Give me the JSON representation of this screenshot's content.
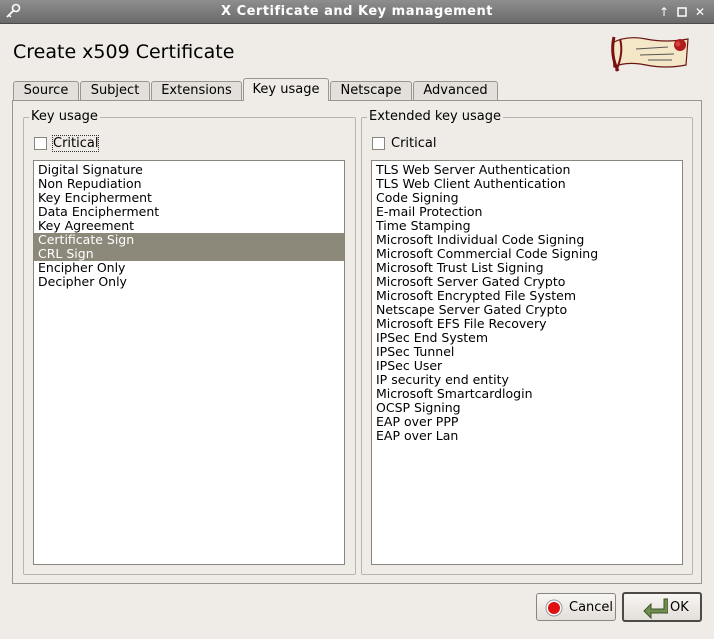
{
  "window": {
    "title": "X Certificate and Key management"
  },
  "header": {
    "title": "Create x509 Certificate"
  },
  "tabs": [
    {
      "label": "Source"
    },
    {
      "label": "Subject"
    },
    {
      "label": "Extensions"
    },
    {
      "label": "Key usage"
    },
    {
      "label": "Netscape"
    },
    {
      "label": "Advanced"
    }
  ],
  "key_usage": {
    "title": "Key usage",
    "critical_label": "Critical",
    "critical_checked": false,
    "items": [
      "Digital Signature",
      "Non Repudiation",
      "Key Encipherment",
      "Data Encipherment",
      "Key Agreement",
      "Certificate Sign",
      "CRL Sign",
      "Encipher Only",
      "Decipher Only"
    ]
  },
  "extended_key_usage": {
    "title": "Extended key usage",
    "critical_label": "Critical",
    "critical_checked": false,
    "items": [
      "TLS Web Server Authentication",
      "TLS Web Client Authentication",
      "Code Signing",
      "E-mail Protection",
      "Time Stamping",
      "Microsoft Individual Code Signing",
      "Microsoft Commercial Code Signing",
      "Microsoft Trust List Signing",
      "Microsoft Server Gated Crypto",
      "Microsoft Encrypted File System",
      "Netscape Server Gated Crypto",
      "Microsoft EFS File Recovery",
      "IPSec End System",
      "IPSec Tunnel",
      "IPSec User",
      "IP security end entity",
      "Microsoft Smartcardlogin",
      "OCSP Signing",
      "EAP over PPP",
      "EAP over Lan"
    ]
  },
  "buttons": {
    "cancel": "Cancel",
    "ok": "OK"
  },
  "colors": {
    "selection": "#8c897b",
    "titlebar": "#7a7a7a"
  }
}
